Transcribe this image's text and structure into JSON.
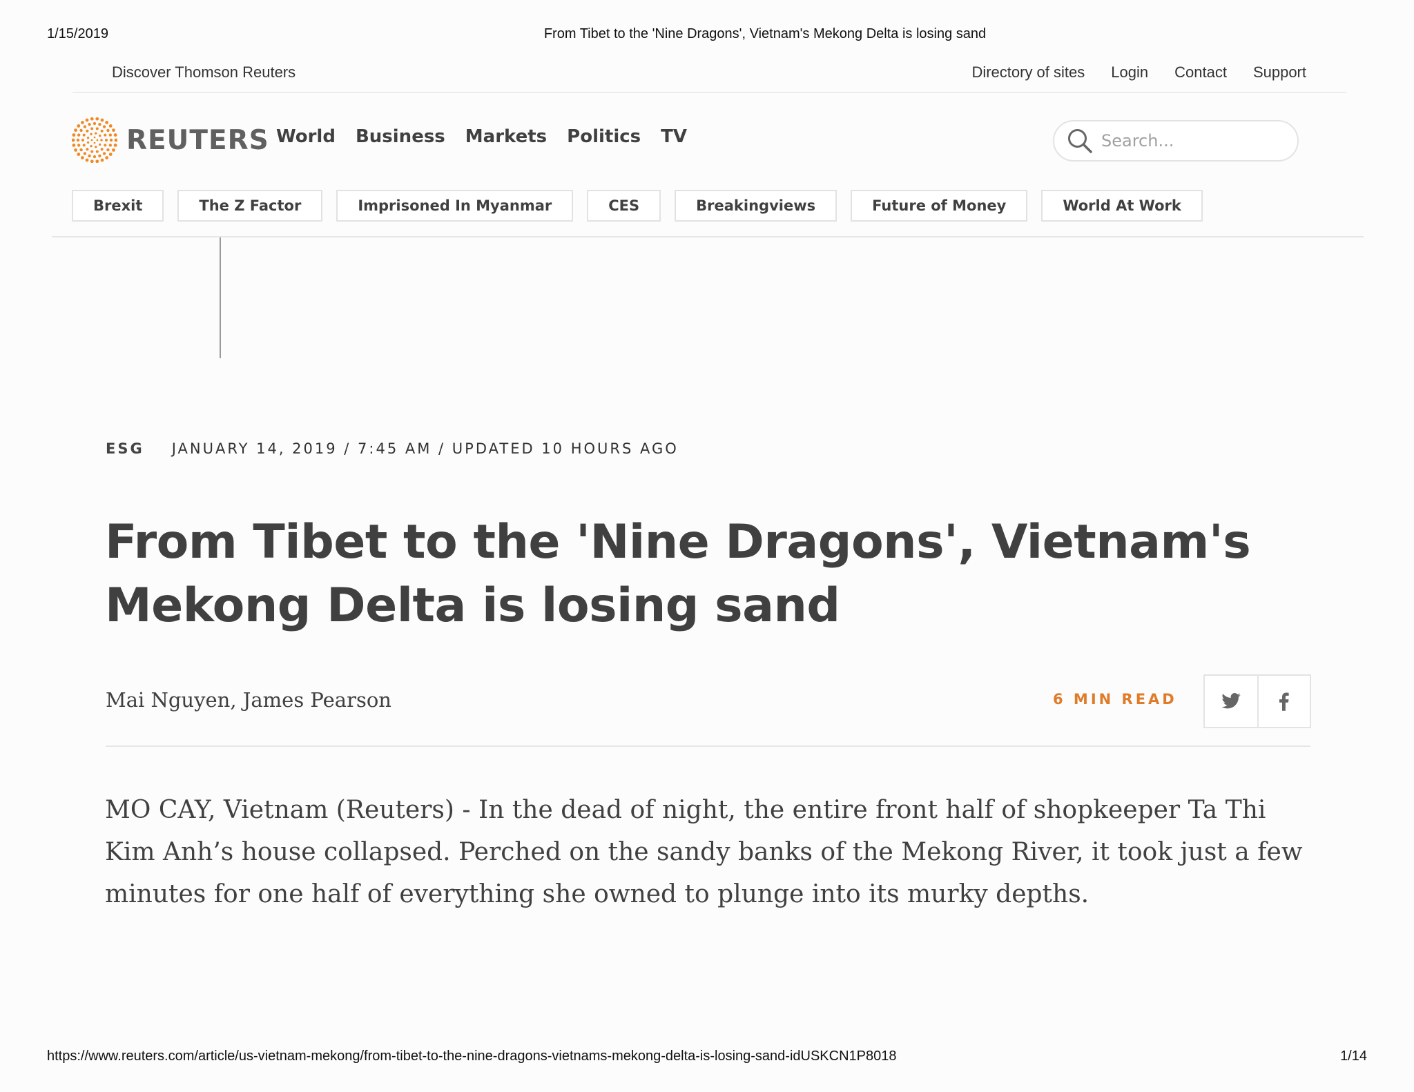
{
  "print_header": {
    "date": "1/15/2019",
    "title": "From Tibet to the 'Nine Dragons', Vietnam's Mekong Delta is losing sand"
  },
  "utility_bar": {
    "left_link": "Discover Thomson Reuters",
    "links": [
      "Directory of sites",
      "Login",
      "Contact",
      "Support"
    ]
  },
  "masthead": {
    "logo_text": "REUTERS",
    "logo_color": "#f08a24",
    "nav": [
      "World",
      "Business",
      "Markets",
      "Politics",
      "TV"
    ],
    "search_placeholder": "Search..."
  },
  "topics": [
    "Brexit",
    "The Z Factor",
    "Imprisoned In Myanmar",
    "CES",
    "Breakingviews",
    "Future of Money",
    "World At Work"
  ],
  "article": {
    "section": "ESG",
    "dateline": "JANUARY 14, 2019 / 7:45 AM / UPDATED 10 HOURS AGO",
    "headline": "From Tibet to the 'Nine Dragons', Vietnam's Mekong Delta is losing sand",
    "byline": "Mai Nguyen, James Pearson",
    "read_time": "6 MIN READ",
    "read_time_color": "#e07b28",
    "share_icons": [
      "twitter-icon",
      "facebook-icon"
    ],
    "lead": "MO CAY, Vietnam (Reuters) - In the dead of night, the entire front half of shopkeeper Ta Thi Kim Anh’s house collapsed. Perched on the sandy banks of the Mekong River, it took just a few minutes for one half of everything she owned to plunge into its murky depths."
  },
  "print_footer": {
    "url": "https://www.reuters.com/article/us-vietnam-mekong/from-tibet-to-the-nine-dragons-vietnams-mekong-delta-is-losing-sand-idUSKCN1P8018",
    "page": "1/14"
  }
}
